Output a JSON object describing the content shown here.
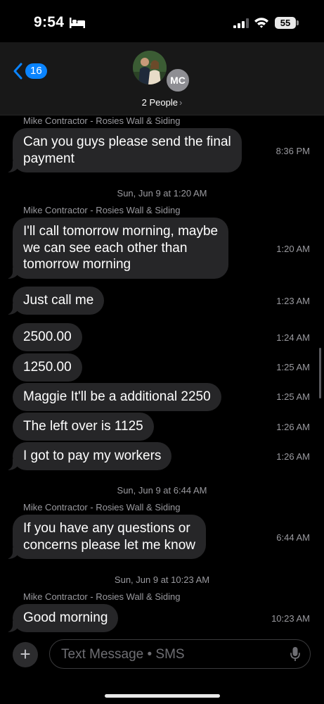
{
  "status_bar": {
    "time": "9:54",
    "battery": "55",
    "icons": [
      "bed-icon",
      "signal-icon",
      "wifi-icon",
      "battery-icon"
    ]
  },
  "header": {
    "back_badge": "16",
    "avatar_initials": "MC",
    "people_label": "2 People",
    "people_chevron": "›"
  },
  "messages": {
    "sender_1": "Mike Contractor - Rosies Wall & Siding",
    "msg_1": [
      "Can you guys please send the final",
      "payment"
    ],
    "time_1": "8:36 PM",
    "date_2": "Sun, Jun 9 at 1:20 AM",
    "sender_2": "Mike Contractor - Rosies Wall & Siding",
    "msg_2": [
      "I'll call tomorrow morning, maybe",
      "we can see each other than",
      "tomorrow morning"
    ],
    "time_2": "1:20 AM",
    "msg_3": "Just call me",
    "time_3": "1:23 AM",
    "msg_4": "2500.00",
    "time_4": "1:24 AM",
    "msg_5": "1250.00",
    "time_5": "1:25 AM",
    "msg_6": "Maggie It'll be a additional 2250",
    "time_6": "1:25 AM",
    "msg_7": "The left over is 1125",
    "time_7": "1:26 AM",
    "msg_8": "I got to pay my workers",
    "time_8": "1:26 AM",
    "date_3": "Sun, Jun 9 at 6:44 AM",
    "sender_3": "Mike Contractor - Rosies Wall & Siding",
    "msg_9": [
      "If you have any questions or",
      "concerns please let me know"
    ],
    "time_9": "6:44 AM",
    "date_4": "Sun, Jun 9 at 10:23 AM",
    "sender_4": "Mike Contractor - Rosies Wall & Siding",
    "msg_10": "Good morning",
    "time_10": "10:23 AM"
  },
  "input": {
    "placeholder": "Text Message • SMS",
    "plus_label": "+"
  },
  "colors": {
    "accent": "#0a84ff",
    "bubble": "#262628",
    "background": "#000000",
    "secondary_text": "#9a9a9f"
  }
}
